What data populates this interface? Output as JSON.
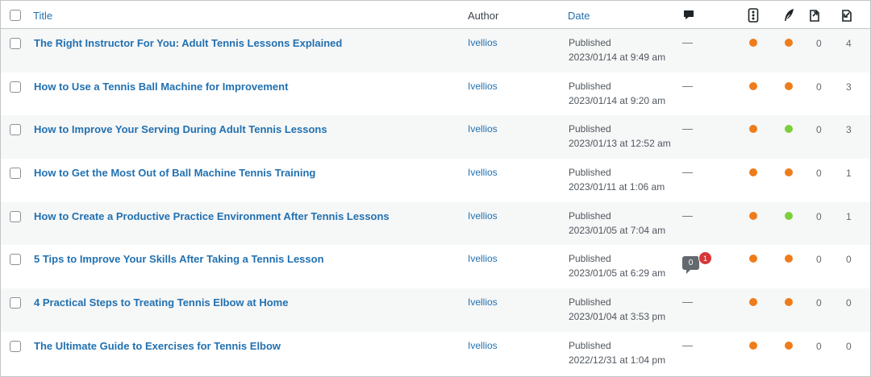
{
  "header": {
    "title": "Title",
    "author": "Author",
    "date": "Date",
    "icons": [
      "comments-icon",
      "seo-score-icon",
      "readability-icon",
      "outgoing-links-icon",
      "incoming-links-icon"
    ]
  },
  "colors": {
    "link": "#2271b1",
    "orange": "#ee7c1b",
    "green": "#7ad03a",
    "comment_bubble": "#646970",
    "pending": "#d63638"
  },
  "rows": [
    {
      "title": "The Right Instructor For You: Adult Tennis Lessons Explained",
      "author": "Ivellios",
      "status": "Published",
      "datetime": "2023/01/14 at 9:49 am",
      "comments": "—",
      "seo": "orange",
      "readability": "orange",
      "outgoing": "0",
      "incoming": "4"
    },
    {
      "title": "How to Use a Tennis Ball Machine for Improvement",
      "author": "Ivellios",
      "status": "Published",
      "datetime": "2023/01/14 at 9:20 am",
      "comments": "—",
      "seo": "orange",
      "readability": "orange",
      "outgoing": "0",
      "incoming": "3"
    },
    {
      "title": "How to Improve Your Serving During Adult Tennis Lessons",
      "author": "Ivellios",
      "status": "Published",
      "datetime": "2023/01/13 at 12:52 am",
      "comments": "—",
      "seo": "orange",
      "readability": "green",
      "outgoing": "0",
      "incoming": "3"
    },
    {
      "title": "How to Get the Most Out of Ball Machine Tennis Training",
      "author": "Ivellios",
      "status": "Published",
      "datetime": "2023/01/11 at 1:06 am",
      "comments": "—",
      "seo": "orange",
      "readability": "orange",
      "outgoing": "0",
      "incoming": "1"
    },
    {
      "title": "How to Create a Productive Practice Environment After Tennis Lessons",
      "author": "Ivellios",
      "status": "Published",
      "datetime": "2023/01/05 at 7:04 am",
      "comments": "—",
      "seo": "orange",
      "readability": "green",
      "outgoing": "0",
      "incoming": "1"
    },
    {
      "title": "5 Tips to Improve Your Skills After Taking a Tennis Lesson",
      "author": "Ivellios",
      "status": "Published",
      "datetime": "2023/01/05 at 6:29 am",
      "comments": "",
      "approved_comments": "0",
      "pending_comments": "1",
      "seo": "orange",
      "readability": "orange",
      "outgoing": "0",
      "incoming": "0"
    },
    {
      "title": "4 Practical Steps to Treating Tennis Elbow at Home",
      "author": "Ivellios",
      "status": "Published",
      "datetime": "2023/01/04 at 3:53 pm",
      "comments": "—",
      "seo": "orange",
      "readability": "orange",
      "outgoing": "0",
      "incoming": "0"
    },
    {
      "title": "The Ultimate Guide to Exercises for Tennis Elbow",
      "author": "Ivellios",
      "status": "Published",
      "datetime": "2022/12/31 at 1:04 pm",
      "comments": "—",
      "seo": "orange",
      "readability": "orange",
      "outgoing": "0",
      "incoming": "0"
    }
  ]
}
